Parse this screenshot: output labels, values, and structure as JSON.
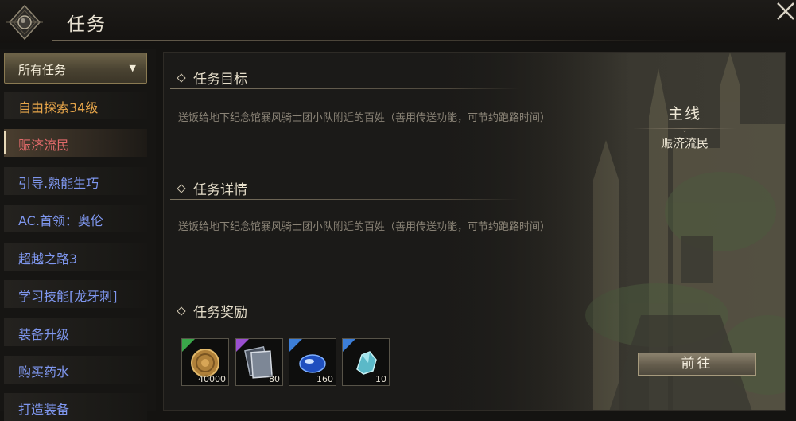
{
  "window": {
    "title": "任务"
  },
  "sidebar": {
    "filter_label": "所有任务",
    "items": [
      {
        "label": "自由探索34级",
        "color": "#e8a64a"
      },
      {
        "label": "赈济流民",
        "color": "#e06a6a",
        "selected": true
      },
      {
        "label": "引导.熟能生巧",
        "color": "#7f97ef"
      },
      {
        "label": "AC.首领：奥伦",
        "color": "#7f97ef"
      },
      {
        "label": "超越之路3",
        "color": "#7f97ef"
      },
      {
        "label": "学习技能[龙牙刺]",
        "color": "#7f97ef"
      },
      {
        "label": "装备升级",
        "color": "#7f97ef"
      },
      {
        "label": "购买药水",
        "color": "#7f97ef"
      },
      {
        "label": "打造装备",
        "color": "#7f97ef"
      }
    ]
  },
  "main": {
    "objective": {
      "heading": "任务目标",
      "text": "送饭给地下纪念馆暴风骑士团小队附近的百姓（善用传送功能，可节约跑路时间）"
    },
    "details": {
      "heading": "任务详情",
      "text": "送饭给地下纪念馆暴风骑士团小队附近的百姓（善用传送功能，可节约跑路时间）"
    },
    "rewards": {
      "heading": "任务奖励",
      "items": [
        {
          "icon": "gold-coin-icon",
          "count": "40000",
          "rarity_color": "#3aa64a"
        },
        {
          "icon": "scroll-card-icon",
          "count": "80",
          "rarity_color": "#9a4fd0"
        },
        {
          "icon": "blue-gem-icon",
          "count": "160",
          "rarity_color": "#3c7ed8"
        },
        {
          "icon": "crystal-shard-icon",
          "count": "10",
          "rarity_color": "#3c7ed8"
        }
      ]
    },
    "quest_type": "主线",
    "quest_name": "赈济流民",
    "go_button_label": "前往"
  },
  "colors": {
    "accent": "#8a7a52",
    "main_quest": "#e8a64a",
    "selected_quest": "#e06a6a",
    "side_quest": "#7f97ef"
  }
}
